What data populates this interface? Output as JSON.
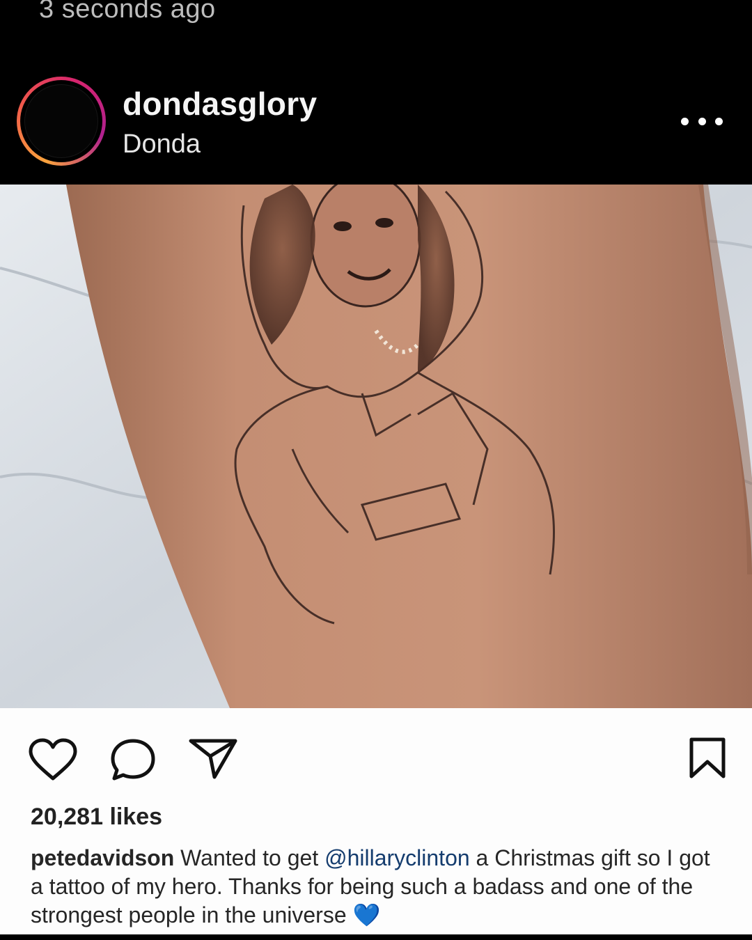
{
  "status": {
    "timestamp": "3 seconds ago"
  },
  "post_header": {
    "username": "dondasglory",
    "subtitle": "Donda",
    "more_icon": "more-horizontal-icon"
  },
  "inner_post": {
    "actions": {
      "like_icon": "heart-icon",
      "comment_icon": "comment-icon",
      "share_icon": "send-icon",
      "save_icon": "bookmark-icon"
    },
    "likes": "20,281 likes",
    "caption": {
      "author": "petedavidson",
      "text_before": "Wanted to get",
      "mention": "@hillaryclinton",
      "text_after": "a Christmas gift so I got a tattoo of my hero. Thanks for being such a badass and one of the strongest people in the universe",
      "emoji": "💙"
    }
  },
  "colors": {
    "background": "#000000",
    "ring_gradient": [
      "#f9a33d",
      "#f15a4a",
      "#d6246e",
      "#b0208f"
    ],
    "skin": "#c58f74",
    "mention": "#143c6e",
    "heart_emoji": "#2e7be0"
  }
}
